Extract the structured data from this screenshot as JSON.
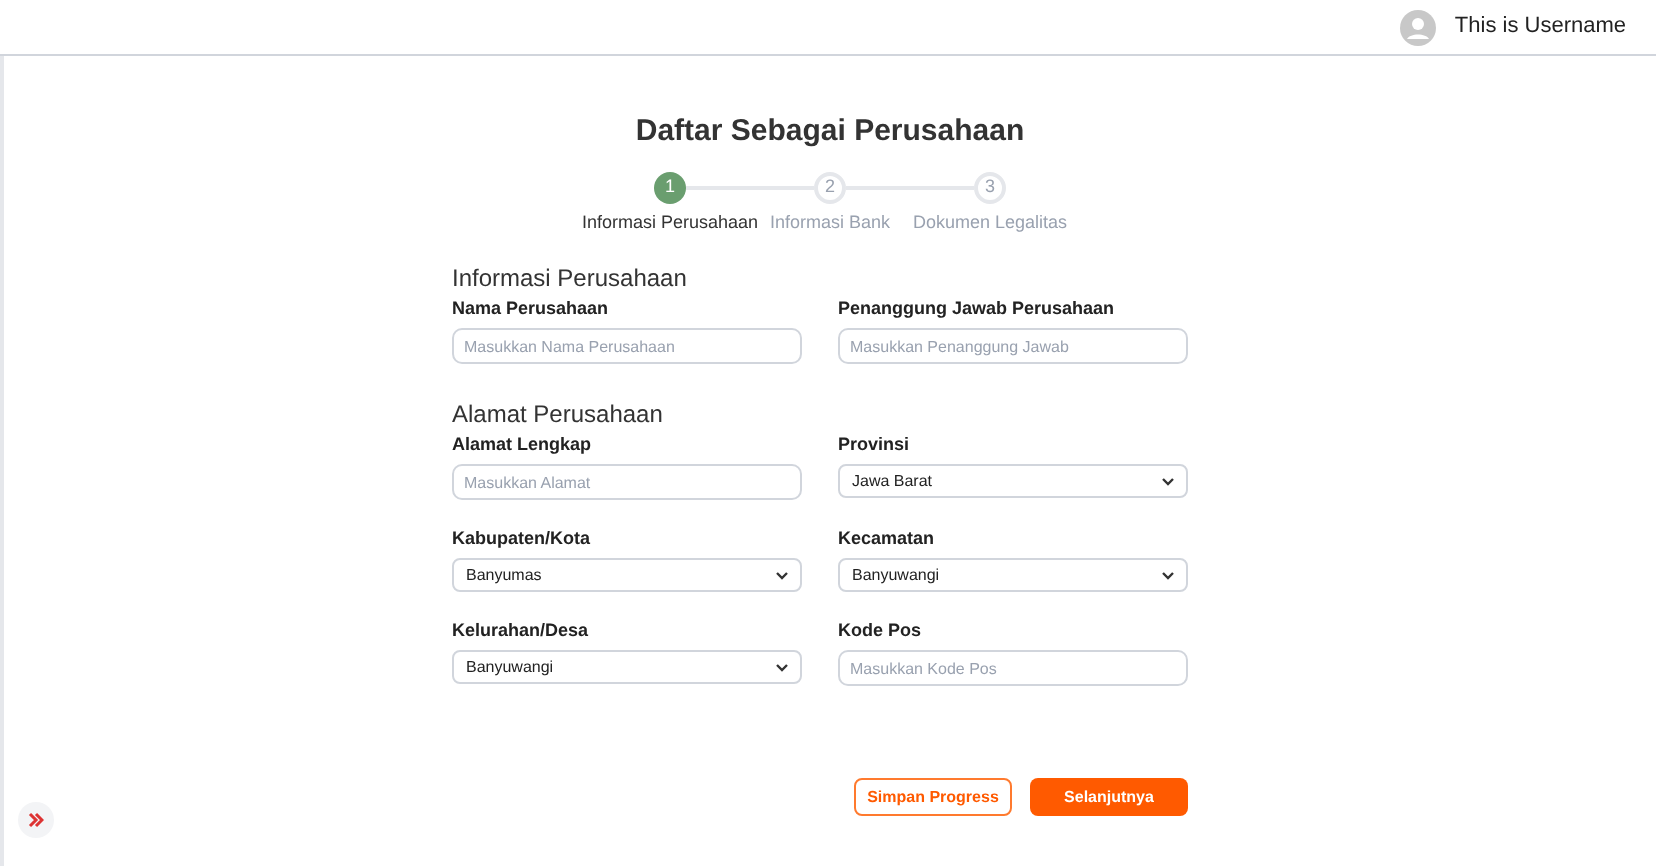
{
  "header": {
    "username": "This is Username"
  },
  "title": "Daftar Sebagai Perusahaan",
  "steps": [
    {
      "number": "1",
      "label": "Informasi Perusahaan",
      "selected": true
    },
    {
      "number": "2",
      "label": "Informasi Bank",
      "selected": false
    },
    {
      "number": "3",
      "label": "Dokumen Legalitas",
      "selected": false
    }
  ],
  "sections": [
    {
      "heading": "Informasi Perusahaan",
      "fields": [
        {
          "kind": "text",
          "label": "Nama Perusahaan",
          "placeholder": "Masukkan Nama Perusahaan"
        },
        {
          "kind": "text",
          "label": "Penanggung Jawab Perusahaan",
          "placeholder": "Masukkan Penanggung Jawab"
        }
      ]
    },
    {
      "heading": "Alamat Perusahaan",
      "fields": [
        {
          "kind": "text",
          "label": "Alamat Lengkap",
          "placeholder": "Masukkan Alamat"
        },
        {
          "kind": "select",
          "label": "Provinsi",
          "value": "Jawa Barat"
        },
        {
          "kind": "select",
          "label": "Kabupaten/Kota",
          "value": "Banyumas"
        },
        {
          "kind": "select",
          "label": "Kecamatan",
          "value": "Banyuwangi"
        },
        {
          "kind": "select",
          "label": "Kelurahan/Desa",
          "value": "Banyuwangi"
        },
        {
          "kind": "text",
          "label": "Kode Pos",
          "placeholder": "Masukkan Kode Pos"
        }
      ]
    }
  ],
  "buttons": [
    {
      "kind": "secondary",
      "label": "Simpan Progress"
    },
    {
      "kind": "primary",
      "label": "Selanjutnya"
    }
  ]
}
